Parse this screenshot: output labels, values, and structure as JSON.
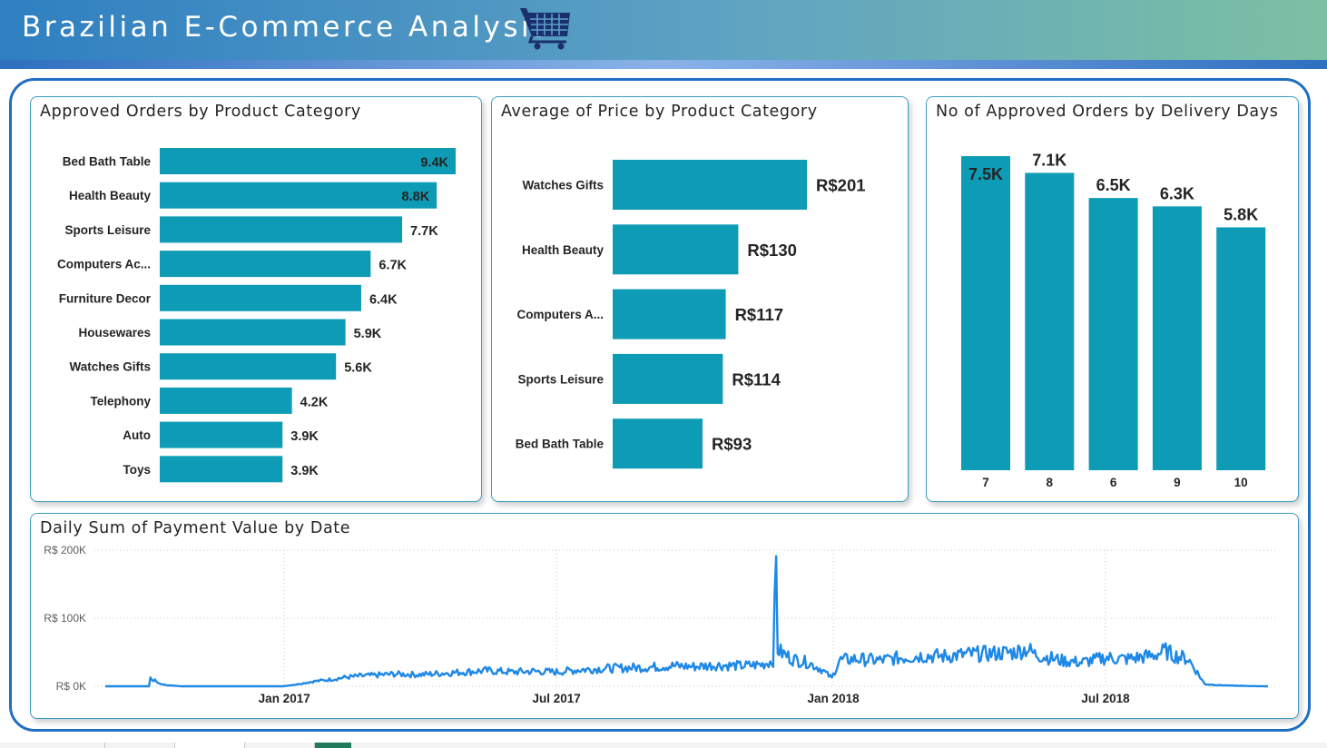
{
  "header": {
    "title": "Brazilian E-Commerce Analysis",
    "icon": "shopping-cart-icon"
  },
  "colors": {
    "bar": "#0e9bb5",
    "line": "#1e88e5",
    "header_start": "#2f7fc1",
    "header_end": "#7cc0a3",
    "frame": "#1f6fc2"
  },
  "charts": [
    {
      "type": "bar",
      "orientation": "horizontal",
      "title": "Approved Orders by Product Category",
      "categories": [
        "Bed Bath Table",
        "Health Beauty",
        "Sports Leisure",
        "Computers Ac...",
        "Furniture Decor",
        "Housewares",
        "Watches Gifts",
        "Telephony",
        "Auto",
        "Toys"
      ],
      "values": [
        9400,
        8800,
        7700,
        6700,
        6400,
        5900,
        5600,
        4200,
        3900,
        3900
      ],
      "labels": [
        "9.4K",
        "8.8K",
        "7.7K",
        "6.7K",
        "6.4K",
        "5.9K",
        "5.6K",
        "4.2K",
        "3.9K",
        "3.9K"
      ]
    },
    {
      "type": "bar",
      "orientation": "horizontal",
      "title": "Average of Price by Product Category",
      "categories": [
        "Watches Gifts",
        "Health Beauty",
        "Computers A...",
        "Sports Leisure",
        "Bed Bath Table"
      ],
      "values": [
        201,
        130,
        117,
        114,
        93
      ],
      "labels": [
        "R$201",
        "R$130",
        "R$117",
        "R$114",
        "R$93"
      ]
    },
    {
      "type": "bar",
      "orientation": "vertical",
      "title": "No of Approved Orders by Delivery Days",
      "categories": [
        "7",
        "8",
        "6",
        "9",
        "10"
      ],
      "values": [
        7500,
        7100,
        6500,
        6300,
        5800
      ],
      "labels": [
        "7.5K",
        "7.1K",
        "6.5K",
        "6.3K",
        "5.8K"
      ]
    },
    {
      "type": "line",
      "title": "Daily Sum of Payment Value by Date",
      "x_ticks": [
        "Jan 2017",
        "Jul 2017",
        "Jan 2018",
        "Jul 2018"
      ],
      "y_ticks": [
        "R$ 200K",
        "R$ 100K",
        "R$ 0K"
      ],
      "ylim": [
        0,
        200000
      ],
      "grid": true,
      "series": [
        {
          "points": [
            [
              "2016-09-04",
              0
            ],
            [
              "2016-10-03",
              0
            ],
            [
              "2016-10-04",
              12000
            ],
            [
              "2016-10-06",
              9000
            ],
            [
              "2016-10-08",
              7000
            ],
            [
              "2016-10-10",
              4000
            ],
            [
              "2016-10-15",
              1500
            ],
            [
              "2016-10-25",
              0
            ],
            [
              "2016-12-31",
              0
            ],
            [
              "2017-01-10",
              3000
            ],
            [
              "2017-01-20",
              7000
            ],
            [
              "2017-02-01",
              10000
            ],
            [
              "2017-02-10",
              13000
            ],
            [
              "2017-02-20",
              15000
            ],
            [
              "2017-03-01",
              16000
            ],
            [
              "2017-03-15",
              18000
            ],
            [
              "2017-04-01",
              17000
            ],
            [
              "2017-04-15",
              19000
            ],
            [
              "2017-05-01",
              21000
            ],
            [
              "2017-05-15",
              23000
            ],
            [
              "2017-06-01",
              21000
            ],
            [
              "2017-06-15",
              22000
            ],
            [
              "2017-07-01",
              21000
            ],
            [
              "2017-07-15",
              24000
            ],
            [
              "2017-08-01",
              26000
            ],
            [
              "2017-08-15",
              27000
            ],
            [
              "2017-09-01",
              28000
            ],
            [
              "2017-09-15",
              30000
            ],
            [
              "2017-10-01",
              29000
            ],
            [
              "2017-10-15",
              31000
            ],
            [
              "2017-11-01",
              30000
            ],
            [
              "2017-11-15",
              32000
            ],
            [
              "2017-11-22",
              38000
            ],
            [
              "2017-11-24",
              180000
            ],
            [
              "2017-11-25",
              55000
            ],
            [
              "2017-11-27",
              50000
            ],
            [
              "2017-12-05",
              40000
            ],
            [
              "2017-12-15",
              35000
            ],
            [
              "2017-12-24",
              25000
            ],
            [
              "2017-12-31",
              12000
            ],
            [
              "2018-01-05",
              38000
            ],
            [
              "2018-01-15",
              40000
            ],
            [
              "2018-02-01",
              38000
            ],
            [
              "2018-02-15",
              42000
            ],
            [
              "2018-03-01",
              45000
            ],
            [
              "2018-03-15",
              44000
            ],
            [
              "2018-04-01",
              47000
            ],
            [
              "2018-04-15",
              48000
            ],
            [
              "2018-05-01",
              50000
            ],
            [
              "2018-05-10",
              55000
            ],
            [
              "2018-05-15",
              47000
            ],
            [
              "2018-06-01",
              38000
            ],
            [
              "2018-06-15",
              35000
            ],
            [
              "2018-07-01",
              42000
            ],
            [
              "2018-07-15",
              40000
            ],
            [
              "2018-08-01",
              45000
            ],
            [
              "2018-08-10",
              52000
            ],
            [
              "2018-08-15",
              46000
            ],
            [
              "2018-08-25",
              40000
            ],
            [
              "2018-08-31",
              20000
            ],
            [
              "2018-09-05",
              3000
            ],
            [
              "2018-09-15",
              1500
            ],
            [
              "2018-10-01",
              500
            ],
            [
              "2018-10-17",
              0
            ]
          ]
        }
      ]
    }
  ]
}
